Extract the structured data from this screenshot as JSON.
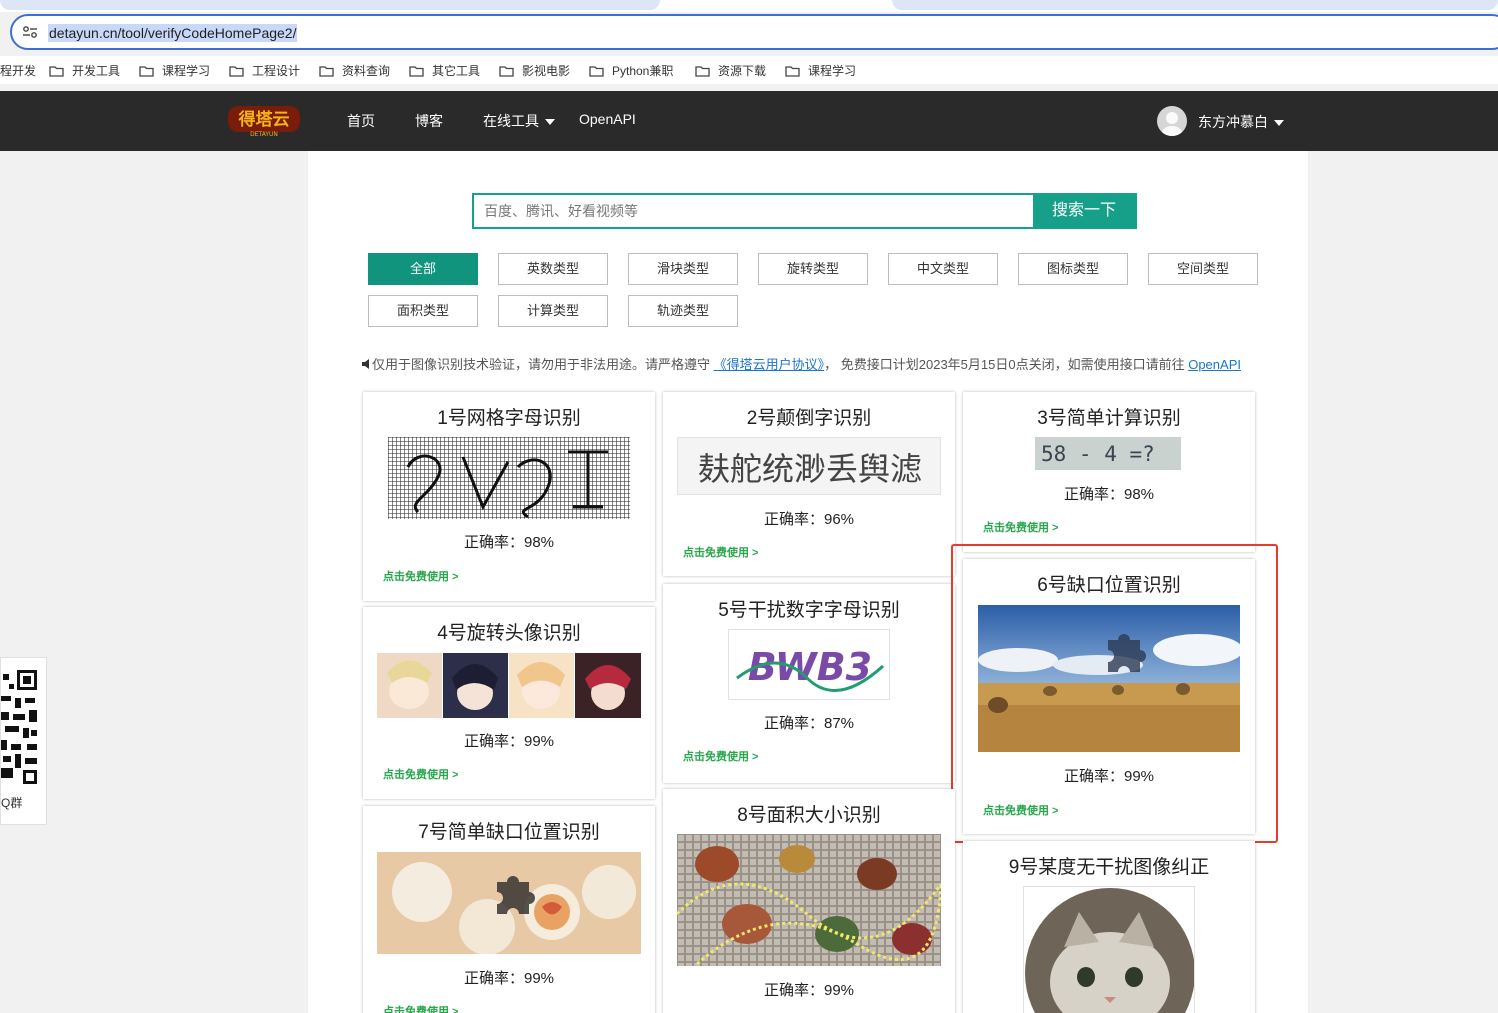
{
  "browser": {
    "url": "detayun.cn/tool/verifyCodeHomePage2/",
    "bookmarks": [
      "程开发",
      "开发工具",
      "课程学习",
      "工程设计",
      "资料查询",
      "其它工具",
      "影视电影",
      "Python兼职",
      "资源下载",
      "课程学习"
    ]
  },
  "nav": {
    "logo_text": "得塔云",
    "logo_sub": "DETAYUN",
    "links": [
      "首页",
      "博客",
      "在线工具",
      "OpenAPI"
    ],
    "username": "东方冲慕白"
  },
  "search": {
    "placeholder": "百度、腾讯、好看视频等",
    "button": "搜索一下"
  },
  "filters": [
    "全部",
    "英数类型",
    "滑块类型",
    "旋转类型",
    "中文类型",
    "图标类型",
    "空间类型",
    "面积类型",
    "计算类型",
    "轨迹类型"
  ],
  "notice": {
    "text_before": "仅用于图像识别技术验证，请勿用于非法用途。请严格遵守 ",
    "agreement_link": "《得塔云用户协议》",
    "text_after": "， 免费接口计划2023年5月15日0点关闭，如需使用接口请前往 ",
    "openapi_link": "OpenAPI"
  },
  "cards": [
    {
      "title": "1号网格字母识别",
      "accuracy": "正确率：98%",
      "link": "点击免费使用 >"
    },
    {
      "title": "2号颠倒字识别",
      "accuracy": "正确率：96%",
      "link": "点击免费使用 >",
      "captcha_text": "麸舵统渺丢舆滤"
    },
    {
      "title": "3号简单计算识别",
      "accuracy": "正确率：98%",
      "link": "点击免费使用 >",
      "captcha_text": "58 - 4 =?"
    },
    {
      "title": "4号旋转头像识别",
      "accuracy": "正确率：99%",
      "link": "点击免费使用 >"
    },
    {
      "title": "5号干扰数字字母识别",
      "accuracy": "正确率：87%",
      "link": "点击免费使用 >",
      "captcha_text": "BWB3"
    },
    {
      "title": "6号缺口位置识别",
      "accuracy": "正确率：99%",
      "link": "点击免费使用 >"
    },
    {
      "title": "7号简单缺口位置识别",
      "accuracy": "正确率：99%",
      "link": "点击免费使用 >"
    },
    {
      "title": "8号面积大小识别",
      "accuracy": "正确率：99%"
    },
    {
      "title": "9号某度无干扰图像纠正"
    }
  ],
  "qr": {
    "label": "Q群"
  }
}
